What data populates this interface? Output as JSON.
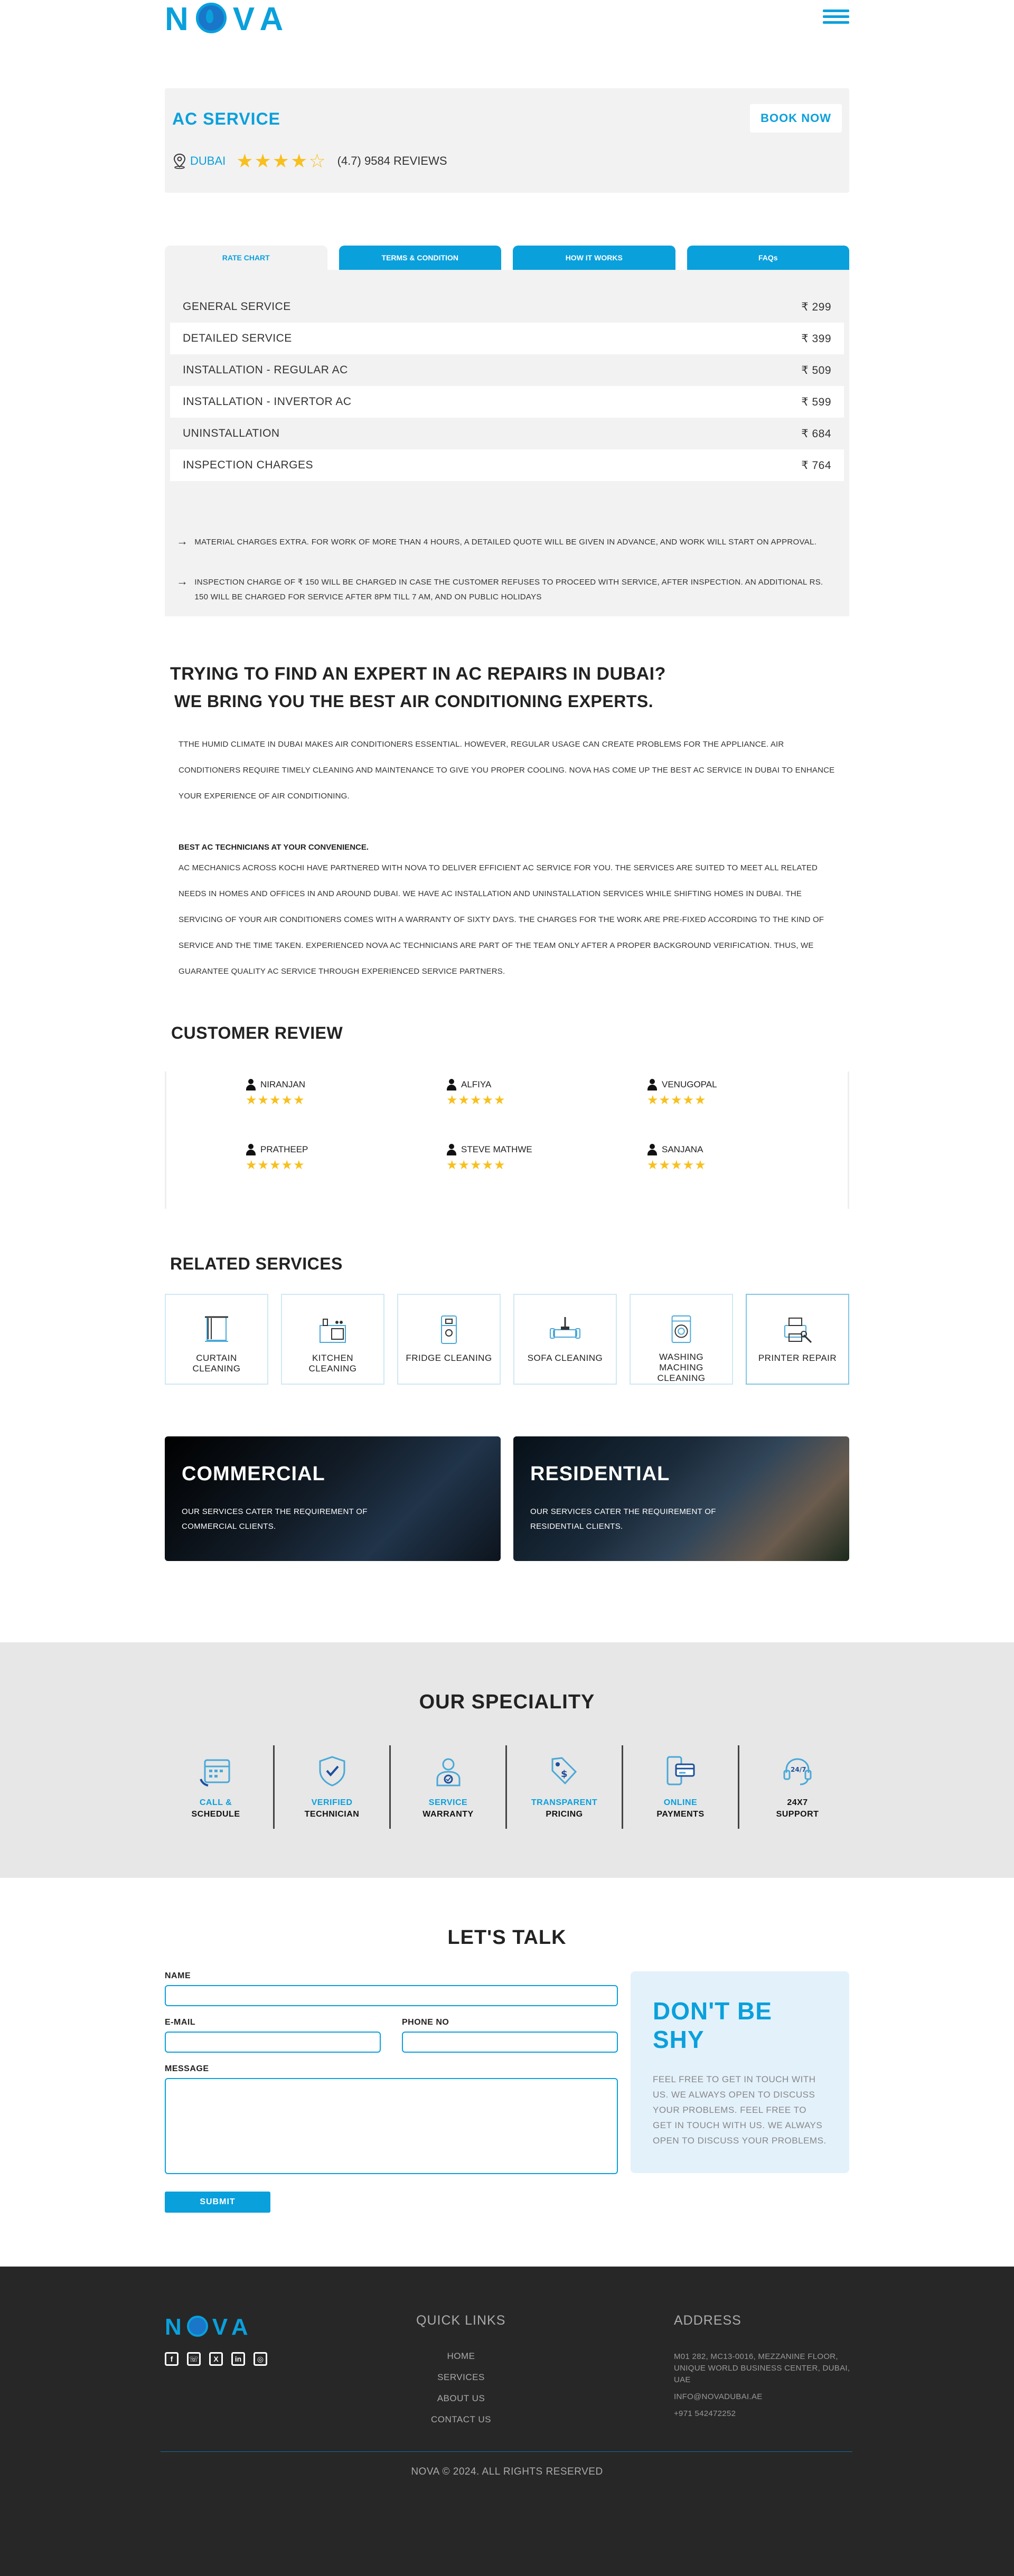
{
  "brand": {
    "logo_text": "NOVA",
    "logo_rest": "VA",
    "logo_first": "N"
  },
  "service": {
    "title": "AC SERVICE",
    "book_label": "BOOK NOW",
    "location": "DUBAI",
    "stars": "★★★★☆",
    "rating": "(4.7) 9584 REVIEWS",
    "rating_value": 4.7
  },
  "tabs": [
    {
      "label": "RATE CHART",
      "active": true
    },
    {
      "label": "TERMS & CONDITION"
    },
    {
      "label": "HOW IT WORKS"
    },
    {
      "label": "FAQs"
    }
  ],
  "rates": [
    {
      "name": "GENERAL SERVICE",
      "price": "₹ 299"
    },
    {
      "name": "DETAILED SERVICE",
      "price": "₹ 399"
    },
    {
      "name": "INSTALLATION - REGULAR AC",
      "price": "₹ 509"
    },
    {
      "name": "INSTALLATION - INVERTOR AC",
      "price": "₹ 599"
    },
    {
      "name": "UNINSTALLATION",
      "price": "₹ 684"
    },
    {
      "name": "INSPECTION CHARGES",
      "price": "₹ 764"
    }
  ],
  "notes": [
    "MATERIAL CHARGES EXTRA. FOR WORK OF MORE THAN 4 HOURS, A DETAILED QUOTE WILL BE GIVEN IN ADVANCE, AND WORK WILL START ON APPROVAL.",
    "INSPECTION CHARGE OF ₹ 150 WILL BE CHARGED IN CASE THE CUSTOMER REFUSES TO PROCEED WITH SERVICE, AFTER INSPECTION. AN ADDITIONAL RS. 150 WILL BE CHARGED FOR SERVICE AFTER 8PM TILL 7 AM, AND ON PUBLIC HOLIDAYS"
  ],
  "about": {
    "heading1": "TRYING TO FIND AN EXPERT IN AC REPAIRS IN DUBAI?",
    "heading2": "WE BRING YOU THE BEST AIR CONDITIONING EXPERTS.",
    "para1": "TTHE HUMID CLIMATE IN DUBAI MAKES AIR CONDITIONERS ESSENTIAL. HOWEVER, REGULAR USAGE CAN CREATE PROBLEMS FOR THE APPLIANCE. AIR CONDITIONERS REQUIRE TIMELY CLEANING AND MAINTENANCE TO GIVE YOU PROPER COOLING. NOVA HAS COME UP THE BEST AC SERVICE IN DUBAI TO ENHANCE YOUR EXPERIENCE OF AIR CONDITIONING.",
    "subheading": "BEST AC TECHNICIANS AT YOUR CONVENIENCE.",
    "para2": "AC MECHANICS ACROSS KOCHI HAVE PARTNERED WITH NOVA TO DELIVER EFFICIENT AC SERVICE FOR YOU. THE SERVICES ARE SUITED TO MEET ALL RELATED NEEDS IN HOMES AND OFFICES IN AND AROUND DUBAI. WE HAVE AC INSTALLATION AND UNINSTALLATION SERVICES WHILE SHIFTING HOMES IN DUBAI. THE SERVICING OF YOUR AIR CONDITIONERS COMES WITH A WARRANTY OF SIXTY DAYS. THE CHARGES FOR THE WORK ARE PRE-FIXED ACCORDING TO THE KIND OF SERVICE AND THE TIME TAKEN. EXPERIENCED NOVA AC TECHNICIANS ARE PART OF THE TEAM ONLY AFTER A PROPER BACKGROUND VERIFICATION. THUS, WE GUARANTEE QUALITY AC SERVICE THROUGH EXPERIENCED SERVICE PARTNERS."
  },
  "reviews": {
    "title": "CUSTOMER REVIEW",
    "items": [
      {
        "name": "NIRANJAN",
        "stars": "★★★★★",
        "rating": 5
      },
      {
        "name": "ALFIYA",
        "stars": "★★★★★",
        "rating": 5
      },
      {
        "name": "VENUGOPAL",
        "stars": "★★★★★",
        "rating": 5
      },
      {
        "name": "PRATHEEP",
        "stars": "★★★★★",
        "rating": 5
      },
      {
        "name": "STEVE MATHWE",
        "stars": "★★★★★",
        "rating": 5
      },
      {
        "name": "SANJANA",
        "stars": "★★★★★",
        "rating": 5
      }
    ]
  },
  "related": {
    "title": "RELATED SERVICES",
    "items": [
      {
        "label": "CURTAIN CLEANING",
        "icon": "curtain-icon"
      },
      {
        "label": "KITCHEN CLEANING",
        "icon": "kitchen-icon"
      },
      {
        "label": "FRIDGE CLEANING",
        "icon": "fridge-icon"
      },
      {
        "label": "SOFA CLEANING",
        "icon": "sofa-icon"
      },
      {
        "label": "WASHING MACHING CLEANING",
        "icon": "washing-machine-icon"
      },
      {
        "label": "PRINTER REPAIR",
        "icon": "printer-icon"
      }
    ]
  },
  "promo": [
    {
      "title": "COMMERCIAL",
      "text": "OUR SERVICES CATER THE REQUIREMENT OF COMMERCIAL CLIENTS."
    },
    {
      "title": "RESIDENTIAL",
      "text": "OUR SERVICES CATER THE REQUIREMENT OF RESIDENTIAL CLIENTS."
    }
  ],
  "speciality": {
    "title": "OUR SPECIALITY",
    "items": [
      {
        "top": "CALL &",
        "bottom": "SCHEDULE",
        "icon": "calendar-icon"
      },
      {
        "top": "VERIFIED",
        "bottom": "TECHNICIAN",
        "icon": "shield-check-icon"
      },
      {
        "top": "SERVICE",
        "bottom": "WARRANTY",
        "icon": "technician-icon"
      },
      {
        "top": "TRANSPARENT",
        "bottom": "PRICING",
        "icon": "price-tag-icon"
      },
      {
        "top": "ONLINE",
        "bottom": "PAYMENTS",
        "icon": "mobile-payment-icon"
      },
      {
        "top": "24X7",
        "bottom": "SUPPORT",
        "icon": "headset-icon"
      }
    ]
  },
  "contact": {
    "title": "LET'S TALK",
    "name_label": "NAME",
    "email_label": "E-MAIL",
    "phone_label": "PHONE NO",
    "message_label": "MESSAGE",
    "submit_label": "SUBMIT",
    "shy_title": "DON'T BE SHY",
    "shy_text": "FEEL FREE TO GET IN TOUCH WITH US. WE ALWAYS OPEN TO DISCUSS YOUR PROBLEMS. FEEL FREE TO GET IN TOUCH WITH US. WE ALWAYS OPEN TO DISCUSS YOUR PROBLEMS."
  },
  "footer": {
    "quick_title": "QUICK LINKS",
    "links": [
      "HOME",
      "SERVICES",
      "ABOUT US",
      "CONTACT US"
    ],
    "address_title": "ADDRESS",
    "address": "M01 282, MC13-0016, MEZZANINE FLOOR, UNIQUE WORLD BUSINESS CENTER, DUBAI, UAE",
    "email": "INFO@NOVADUBAI.AE",
    "phone": "+971 542472252",
    "copyright": "NOVA © 2024. ALL RIGHTS RESERVED",
    "social": [
      {
        "icon": "facebook-icon",
        "glyph": "f"
      },
      {
        "icon": "whatsapp-icon",
        "glyph": "☏"
      },
      {
        "icon": "x-icon",
        "glyph": "X"
      },
      {
        "icon": "linkedin-icon",
        "glyph": "in"
      },
      {
        "icon": "instagram-icon",
        "glyph": "◎"
      }
    ]
  },
  "colors": {
    "accent": "#0aa0dc",
    "star": "#f7c01e",
    "footer_bg": "#272727",
    "speciality_bg": "#e7e7e7"
  }
}
